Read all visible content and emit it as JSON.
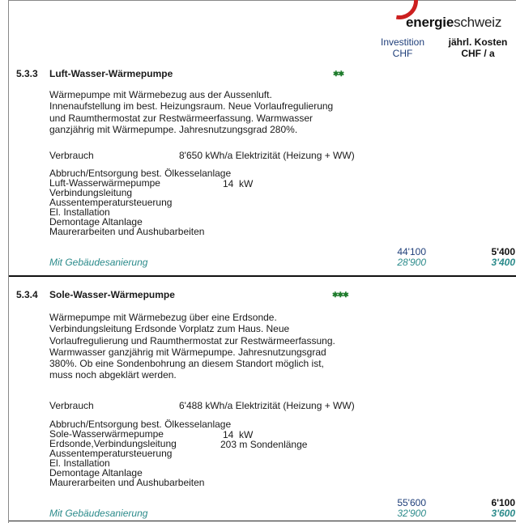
{
  "logo": {
    "bold": "energie",
    "normal": "schweiz"
  },
  "columns": {
    "invest_line1": "Investition",
    "invest_line2": "CHF",
    "cost_line1": "jährl. Kosten",
    "cost_line2": "CHF / a"
  },
  "sections": [
    {
      "number": "5.3.3",
      "title": "Luft-Wasser-Wärmepumpe",
      "stars": "✱✱",
      "description": [
        "Wärmepumpe mit Wärmebezug aus der Aussenluft.",
        "Innenaufstellung im best. Heizungsraum. Neue Vorlaufregulierung",
        "und Raumthermostat zur Restwärmeerfassung. Warmwasser",
        "ganzjährig mit Wärmepumpe. Jahresnutzungsgrad 280%."
      ],
      "verbrauch_label": "Verbrauch",
      "verbrauch_value": "8'650 kWh/a Elektrizität (Heizung + WW)",
      "items": [
        "Abbruch/Entsorgung best. Ölkesselanlage",
        "Luft-Wasserwärmepumpe",
        "Verbindungsleitung",
        "Aussentemperatursteuerung",
        "El. Installation",
        "Demontage Altanlage",
        "Maurerarbeiten und Aushubarbeiten"
      ],
      "item_extra": {
        "power": "14",
        "unit": "kW"
      },
      "investment": "44'100",
      "annual_cost": "5'400",
      "renovation_label": "Mit Gebäudesanierung",
      "renovation_investment": "28'900",
      "renovation_annual_cost": "3'400"
    },
    {
      "number": "5.3.4",
      "title": "Sole-Wasser-Wärmepumpe",
      "stars": "✱✱✱",
      "description": [
        "Wärmepumpe mit Wärmebezug über eine Erdsonde.",
        "Verbindungsleitung Erdsonde Vorplatz zum Haus. Neue",
        "Vorlaufregulierung und Raumthermostat zur Restwärmeerfassung.",
        "Warmwasser ganzjährig mit Wärmepumpe. Jahresnutzungsgrad",
        "380%. Ob eine Sondenbohrung an diesem Standort möglich ist,",
        "muss noch abgeklärt werden."
      ],
      "verbrauch_label": "Verbrauch",
      "verbrauch_value": "6'488 kWh/a Elektrizität (Heizung + WW)",
      "items": [
        "Abbruch/Entsorgung best. Ölkesselanlage",
        "Sole-Wasserwärmepumpe",
        "Erdsonde,Verbindungsleitung",
        "Aussentemperatursteuerung",
        "El. Installation",
        "Demontage Altanlage",
        "Maurerarbeiten und Aushubarbeiten"
      ],
      "item_extra": {
        "power": "14",
        "unit": "kW",
        "probe_length": "203",
        "probe_unit": "m Sondenlänge"
      },
      "investment": "55'600",
      "annual_cost": "6'100",
      "renovation_label": "Mit Gebäudesanierung",
      "renovation_investment": "32'900",
      "renovation_annual_cost": "3'600"
    }
  ]
}
